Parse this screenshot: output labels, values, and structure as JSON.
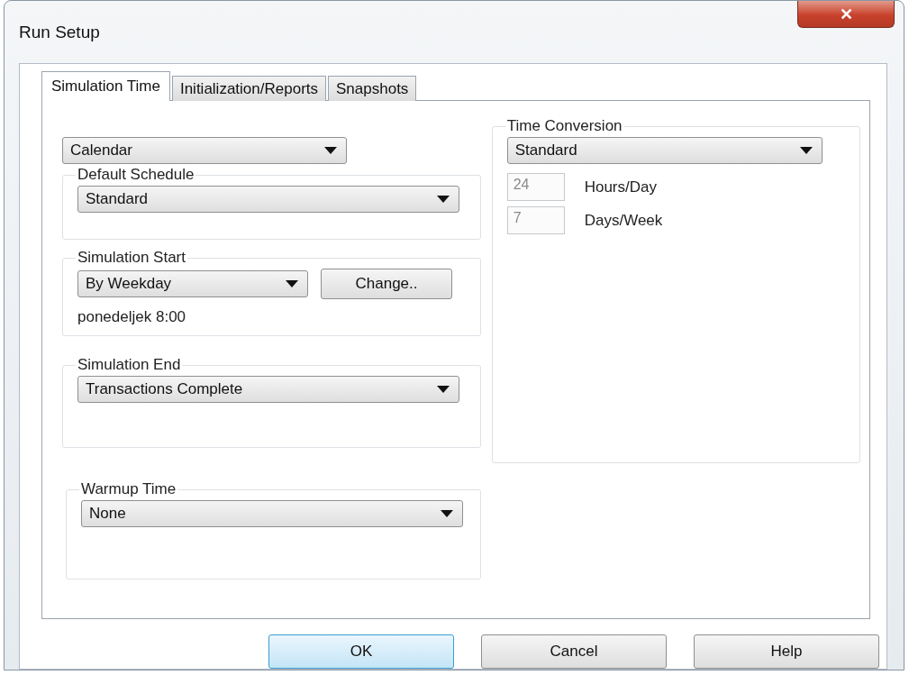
{
  "window": {
    "title": "Run Setup",
    "close": "✕"
  },
  "tabs": [
    {
      "label": "Simulation Time",
      "selected": true
    },
    {
      "label": "Initialization/Reports",
      "selected": false
    },
    {
      "label": "Snapshots",
      "selected": false
    }
  ],
  "calendar": {
    "value": "Calendar"
  },
  "default_schedule": {
    "title": "Default Schedule",
    "value": "Standard"
  },
  "simulation_start": {
    "title": "Simulation Start",
    "value": "By Weekday",
    "button": "Change..",
    "summary": "ponedeljek 8:00"
  },
  "simulation_end": {
    "title": "Simulation End",
    "value": "Transactions Complete"
  },
  "warmup_time": {
    "title": "Warmup Time",
    "value": "None"
  },
  "time_conversion": {
    "title": "Time Conversion",
    "value": "Standard",
    "fields": [
      {
        "value": "24",
        "label": "Hours/Day",
        "disabled": true
      },
      {
        "value": "7",
        "label": "Days/Week",
        "disabled": true
      }
    ]
  },
  "buttons": [
    {
      "label": "OK",
      "default": true
    },
    {
      "label": "Cancel",
      "default": false
    },
    {
      "label": "Help",
      "default": false
    }
  ]
}
